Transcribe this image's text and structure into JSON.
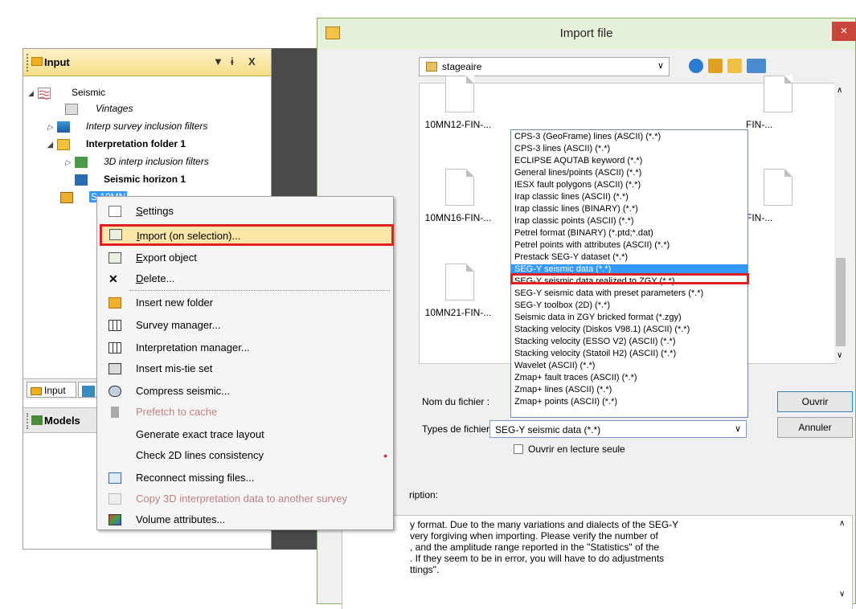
{
  "input_panel": {
    "title": "Input",
    "pin": "▼",
    "pin2": "ɨ",
    "close": "X",
    "tree": [
      {
        "label": "Seismic",
        "style": "normal",
        "indent": 0,
        "exp": "◢"
      },
      {
        "label": "Vintages",
        "style": "italic",
        "indent": 1,
        "exp": ""
      },
      {
        "label": "Interp survey inclusion filters",
        "style": "italic",
        "indent": 1,
        "exp": "▷"
      },
      {
        "label": "Interpretation folder 1",
        "style": "bold",
        "indent": 1,
        "exp": "◢"
      },
      {
        "label": "3D interp inclusion filters",
        "style": "italic",
        "indent": 2,
        "exp": "▷"
      },
      {
        "label": "Seismic horizon 1",
        "style": "bold",
        "indent": 2,
        "exp": ""
      },
      {
        "label": "S    10MN",
        "style": "normal",
        "indent": 1,
        "exp": ""
      }
    ],
    "bottom_tabs": [
      "Input",
      ""
    ],
    "models_title": "Models"
  },
  "context_menu": {
    "items": [
      {
        "label": "Settings",
        "underline": "S",
        "rest": "ettings",
        "icon": "settings-icon",
        "disabled": false
      },
      {
        "label": "Import (on selection)...",
        "underline": "I",
        "rest": "mport (on selection)...",
        "icon": "import-icon",
        "disabled": false
      },
      {
        "label": "Export object",
        "underline": "E",
        "rest": "xport object",
        "icon": "export-icon",
        "disabled": false
      },
      {
        "label": "Delete...",
        "underline": "D",
        "rest": "elete...",
        "icon": "delete-icon",
        "disabled": false
      },
      {
        "label": "Insert new folder",
        "underline": "",
        "rest": "Insert new folder",
        "icon": "folder-icon",
        "disabled": false
      },
      {
        "label": "Survey manager...",
        "underline": "",
        "rest": "Survey manager...",
        "icon": "grid-icon",
        "disabled": false
      },
      {
        "label": "Interpretation manager...",
        "underline": "",
        "rest": "Interpretation manager...",
        "icon": "grid-icon",
        "disabled": false
      },
      {
        "label": "Insert mis-tie set",
        "underline": "",
        "rest": "Insert mis-tie set",
        "icon": "mistie-icon",
        "disabled": false
      },
      {
        "label": "Compress seismic...",
        "underline": "",
        "rest": "Compress seismic...",
        "icon": "compress-icon",
        "disabled": false
      },
      {
        "label": "Prefetch to cache",
        "underline": "",
        "rest": "Prefetch to cache",
        "icon": "cache-icon",
        "disabled": true
      },
      {
        "label": "Generate exact trace layout",
        "underline": "",
        "rest": "Generate exact trace layout",
        "icon": "",
        "disabled": false
      },
      {
        "label": "Check 2D lines consistency",
        "underline": "",
        "rest": "Check 2D lines consistency",
        "icon": "",
        "disabled": false
      },
      {
        "label": "Reconnect missing files...",
        "underline": "",
        "rest": "Reconnect missing files...",
        "icon": "reconnect-icon",
        "disabled": false
      },
      {
        "label": "Copy 3D interpretation data to another survey",
        "underline": "",
        "rest": "Copy 3D interpretation data to another survey",
        "icon": "copy-icon",
        "disabled": true
      },
      {
        "label": "Volume attributes...",
        "underline": "",
        "rest": "Volume attributes...",
        "icon": "volume-icon",
        "disabled": false
      }
    ]
  },
  "dialog": {
    "title": "Import file",
    "close": "×",
    "path": "stageaire",
    "files": [
      "10MN12-FIN-...",
      "10MN16-FIN-...",
      "10MN21-FIN-...",
      "FIN-...",
      "FIN-..."
    ],
    "file_types": [
      "CPS-3 (GeoFrame) lines (ASCII) (*.*)",
      "CPS-3 lines (ASCII) (*.*)",
      "ECLIPSE AQUTAB keyword (*.*)",
      "General lines/points (ASCII) (*.*)",
      "IESX fault polygons (ASCII) (*.*)",
      "Irap classic lines (ASCII) (*.*)",
      "Irap classic lines (BINARY) (*.*)",
      "Irap classic points (ASCII) (*.*)",
      "Petrel format (BINARY) (*.ptd;*.dat)",
      "Petrel points with attributes (ASCII) (*.*)",
      "Prestack SEG-Y dataset (*.*)",
      "SEG-Y seismic data (*.*)",
      "SEG-Y seismic data realized to ZGY (*.*)",
      "SEG-Y seismic data with preset parameters (*.*)",
      "SEG-Y toolbox (2D) (*.*)",
      "Seismic data in ZGY bricked format (*.zgy)",
      "Stacking velocity (Diskos V98.1) (ASCII) (*.*)",
      "Stacking velocity (ESSO V2) (ASCII) (*.*)",
      "Stacking velocity (Statoil H2) (ASCII) (*.*)",
      "Wavelet (ASCII) (*.*)",
      "Zmap+ fault traces (ASCII) (*.*)",
      "Zmap+ lines (ASCII) (*.*)",
      "Zmap+ points (ASCII) (*.*)"
    ],
    "selected_type_index": 11,
    "filename_label": "Nom du fichier :",
    "filetypes_label": "Types de fichiers :",
    "filetypes_value": "SEG-Y seismic data (*.*)",
    "open_button": "Ouvrir",
    "cancel_button": "Annuler",
    "readonly_label": "Ouvrir en lecture seule",
    "description_label": "ription:",
    "description_lines": [
      "y format.  Due to the many variations and dialects of the SEG-Y",
      "very forgiving when importing.  Please verify the number of",
      ", and the amplitude range reported in the \"Statistics\" of the",
      ".  If they seem to be in error, you will have to do adjustments",
      "ttings\"."
    ]
  }
}
